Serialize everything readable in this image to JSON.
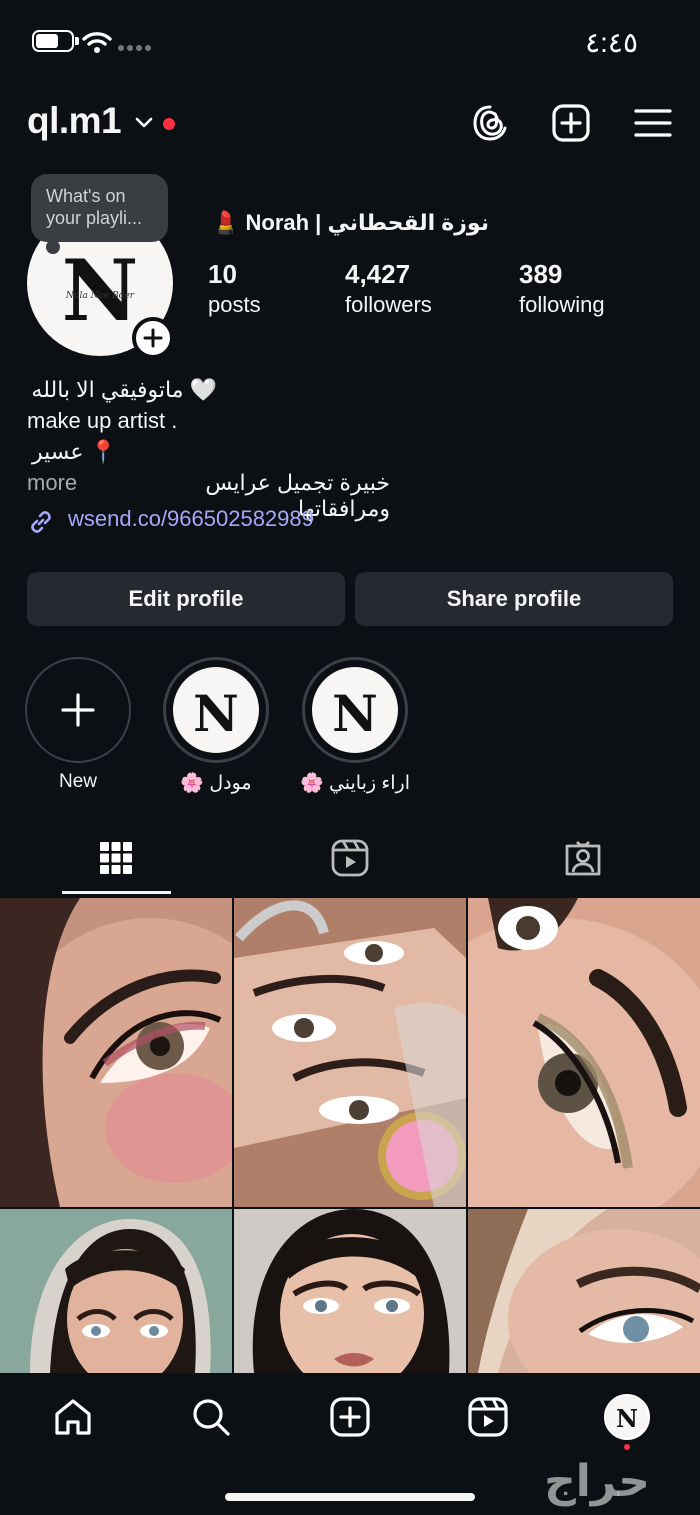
{
  "status_bar": {
    "time": "٤:٤٥"
  },
  "header": {
    "username": "ql.m1",
    "icons": [
      "threads-icon",
      "create-icon",
      "menu-icon"
    ]
  },
  "note": {
    "text": "What's on your playli..."
  },
  "profile": {
    "full_name": "💄 Norah | نوزة القحطاني",
    "stats": [
      {
        "value": "10",
        "label": "posts"
      },
      {
        "value": "4,427",
        "label": "followers"
      },
      {
        "value": "389",
        "label": "following"
      }
    ],
    "bio": [
      "🤍 ماتوفيقي الا بالله",
      "make up artist .",
      "📍 عسير",
      "خبيرة تجميل عرايس ومرافقاتها"
    ],
    "more_label": "more",
    "link": "wsend.co/966502582989"
  },
  "buttons": {
    "edit": "Edit profile",
    "share": "Share profile"
  },
  "highlights": [
    {
      "label": "New"
    },
    {
      "label": "🌸 مودل"
    },
    {
      "label": "🌸 اراء زبايني"
    }
  ],
  "avatar_monogram": "N",
  "avatar_script": "Nula Nae Bder",
  "tabs": [
    "grid-icon",
    "reels-icon",
    "tagged-icon"
  ],
  "nav": [
    "home-icon",
    "search-icon",
    "create-icon",
    "reels-icon",
    "profile-avatar"
  ],
  "watermark_text": "حراج",
  "colors": {
    "background": "#0c1014",
    "button": "#262a30",
    "link": "#a4a8f8",
    "notification": "#ff3040"
  }
}
